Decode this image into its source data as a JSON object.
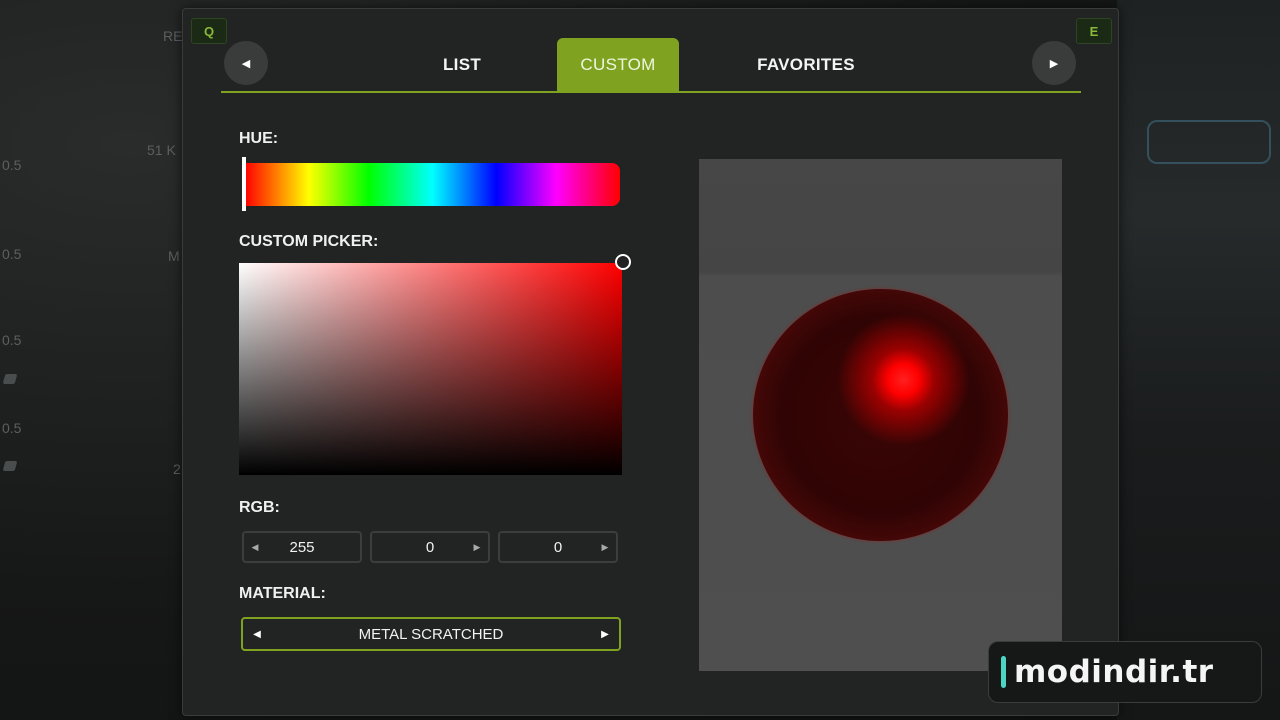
{
  "background": {
    "texts": [
      "RE",
      "51 K",
      "M",
      "0.5",
      "0.5",
      "0.5",
      "0.5",
      "2"
    ]
  },
  "keys": {
    "left": "Q",
    "right": "E"
  },
  "tabs": [
    {
      "label": "LIST",
      "active": false
    },
    {
      "label": "CUSTOM",
      "active": true
    },
    {
      "label": "FAVORITES",
      "active": false
    }
  ],
  "nav": {
    "prev_icon": "◀",
    "next_icon": "▶"
  },
  "hue": {
    "label": "HUE:",
    "value_fraction": 0.0
  },
  "picker": {
    "label": "CUSTOM PICKER:",
    "saturation": 1.0,
    "brightness": 1.0
  },
  "rgb": {
    "label": "RGB:",
    "r": "255",
    "g": "0",
    "b": "0",
    "left_arrow": "◀",
    "right_arrow": "▶"
  },
  "material": {
    "label": "MATERIAL:",
    "value": "METAL SCRATCHED",
    "left_arrow": "◀",
    "right_arrow": "▶"
  },
  "preview": {
    "color": "#ff0000"
  },
  "watermark": {
    "text": "modindir.tr"
  },
  "colors": {
    "accent": "#7fa321",
    "panel": "#222323",
    "selected": "#ff0000"
  }
}
